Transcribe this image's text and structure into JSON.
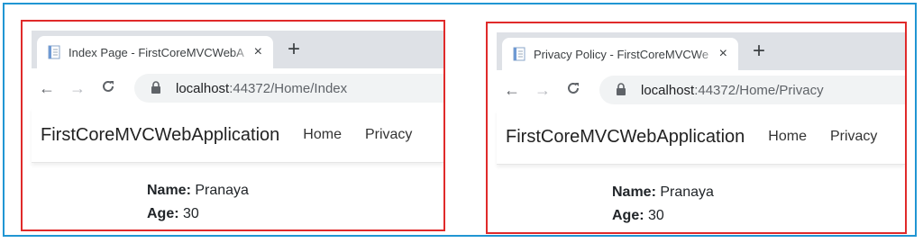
{
  "panels": [
    {
      "tab_title": "Index Page - FirstCoreMVCWebA",
      "url_host": "localhost",
      "url_rest": ":44372/Home/Index",
      "brand": "FirstCoreMVCWebApplication",
      "nav_home": "Home",
      "nav_privacy": "Privacy",
      "name_label": "Name:",
      "name_value": " Pranaya",
      "age_label": "Age:",
      "age_value": " 30"
    },
    {
      "tab_title": "Privacy Policy - FirstCoreMVCWe",
      "url_host": "localhost",
      "url_rest": ":44372/Home/Privacy",
      "brand": "FirstCoreMVCWebApplication",
      "nav_home": "Home",
      "nav_privacy": "Privacy",
      "name_label": "Name:",
      "name_value": " Pranaya",
      "age_label": "Age:",
      "age_value": " 30"
    }
  ],
  "icons": {
    "close": "×",
    "new_tab": "+",
    "back": "←",
    "forward": "→",
    "reload": "C"
  },
  "colors": {
    "outer_border": "#2196d3",
    "panel_border": "#e02a2a",
    "tab_strip": "#dee1e6",
    "omnibox": "#f1f3f4"
  }
}
